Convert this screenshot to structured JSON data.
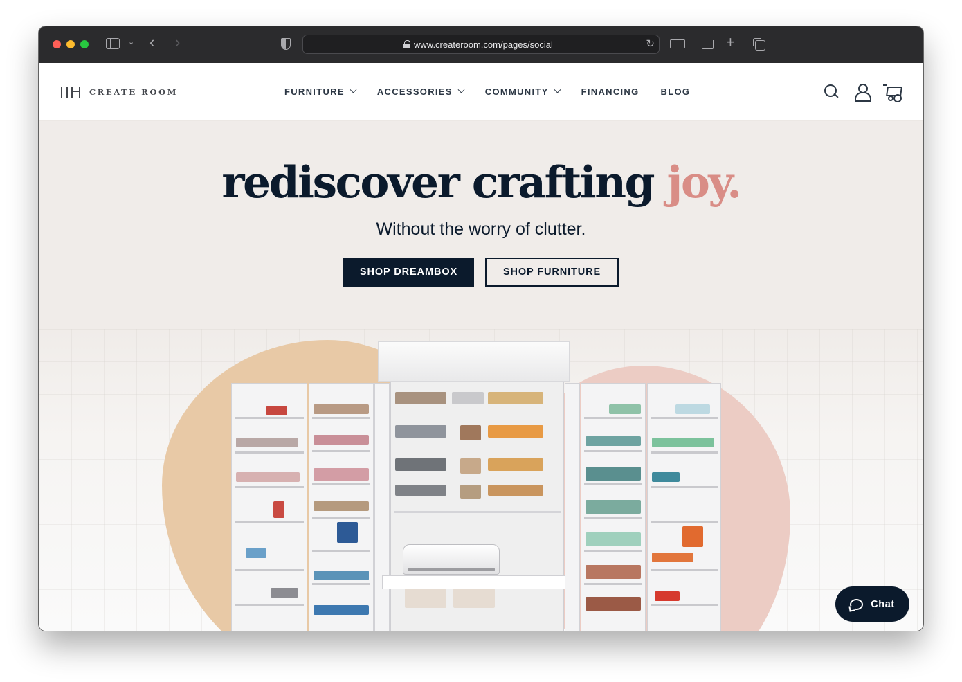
{
  "browser": {
    "url": "www.createroom.com/pages/social"
  },
  "site": {
    "logo_text": "CREATE ROOM",
    "nav": [
      {
        "label": "FURNITURE",
        "has_dropdown": true
      },
      {
        "label": "ACCESSORIES",
        "has_dropdown": true
      },
      {
        "label": "COMMUNITY",
        "has_dropdown": true
      },
      {
        "label": "FINANCING",
        "has_dropdown": false
      },
      {
        "label": "BLOG",
        "has_dropdown": false
      }
    ],
    "header_icons": [
      "search-icon",
      "account-icon",
      "cart-icon"
    ]
  },
  "hero": {
    "headline_main": "rediscover crafting",
    "headline_accent": "joy.",
    "subheadline": "Without the worry of clutter.",
    "primary_button": "SHOP DREAMBOX",
    "secondary_button": "SHOP FURNITURE",
    "colors": {
      "navy": "#0b1a2c",
      "accent_pink": "#d98d86",
      "blob_peach": "#e8c9a6",
      "blob_pink": "#ecccc4",
      "background": "#f0ece9"
    }
  },
  "chat": {
    "label": "Chat",
    "icon": "chat-bubble-icon"
  }
}
